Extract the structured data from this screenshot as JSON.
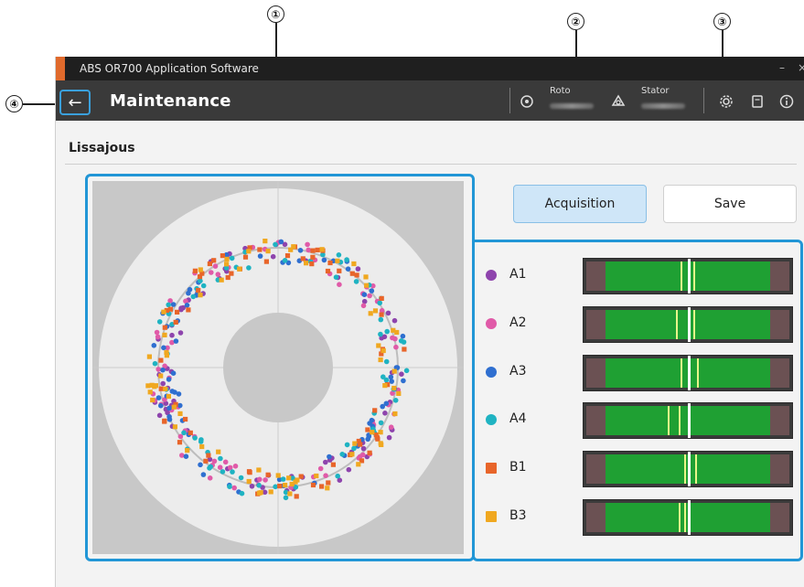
{
  "window": {
    "app_title": "ABS OR700 Application Software",
    "minimize_glyph": "–",
    "close_glyph": "×"
  },
  "header": {
    "back_glyph": "←",
    "page_title": "Maintenance",
    "rotor_label": "Roto",
    "stator_label": "Stator",
    "icons": [
      "rotor-icon",
      "stator-icon",
      "settings-icon",
      "manual-icon",
      "info-icon"
    ]
  },
  "section": {
    "title": "Lissajous"
  },
  "buttons": {
    "acquisition": "Acquisition",
    "save": "Save"
  },
  "channels": [
    {
      "label": "A1",
      "marker": "circle",
      "color": "#8e44ad",
      "cursor_fractions": [
        0.46,
        0.52
      ]
    },
    {
      "label": "A2",
      "marker": "circle",
      "color": "#e05aa8",
      "cursor_fractions": [
        0.44,
        0.52
      ]
    },
    {
      "label": "A3",
      "marker": "circle",
      "color": "#2f6fd0",
      "cursor_fractions": [
        0.46,
        0.54
      ]
    },
    {
      "label": "A4",
      "marker": "circle",
      "color": "#1fb3c2",
      "cursor_fractions": [
        0.4,
        0.45
      ]
    },
    {
      "label": "B1",
      "marker": "square",
      "color": "#e8652a",
      "cursor_fractions": [
        0.48,
        0.53
      ]
    },
    {
      "label": "B3",
      "marker": "square",
      "color": "#f0a820",
      "cursor_fractions": [
        0.45,
        0.48
      ]
    }
  ],
  "callouts": [
    "①",
    "②",
    "③",
    "④"
  ],
  "colors": {
    "accent": "#2196d6",
    "header_bg": "#3a3a3a",
    "title_bar_bg": "#1f1f1f",
    "brand_orange": "#e06a2c"
  }
}
